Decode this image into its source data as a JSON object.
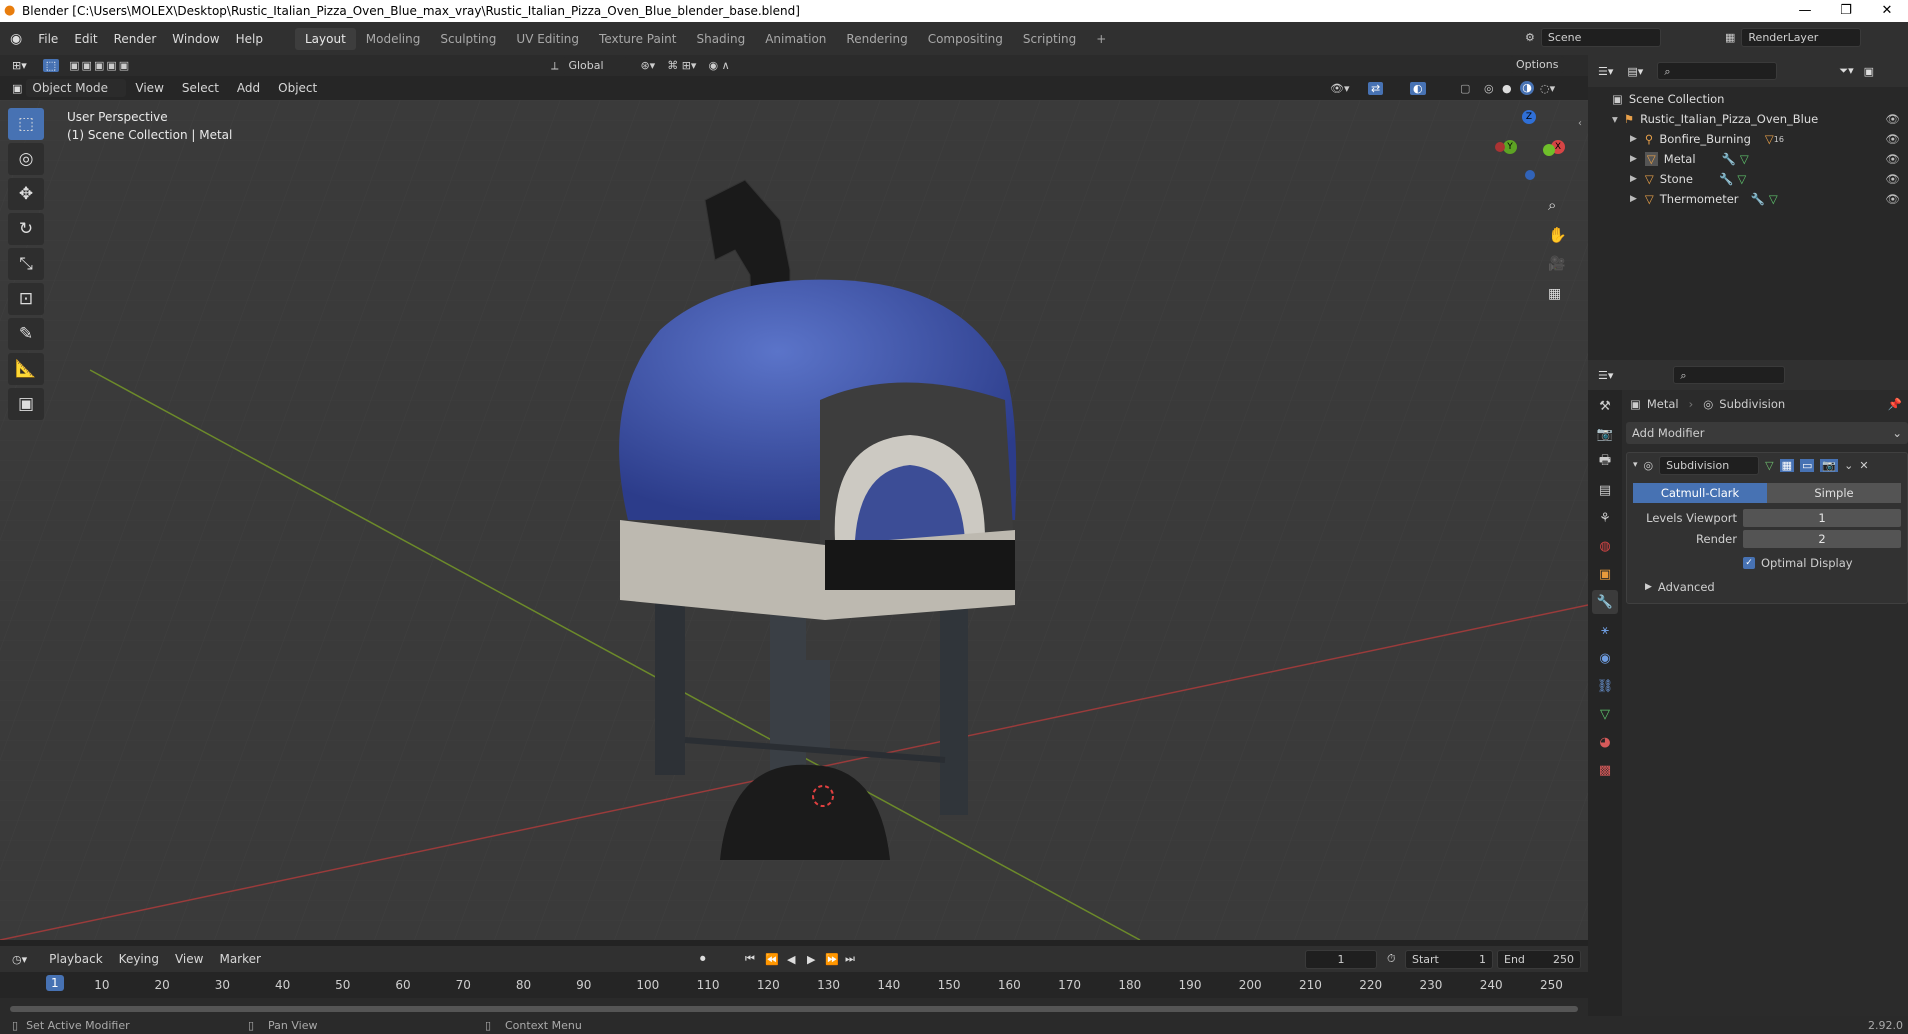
{
  "window": {
    "title": "Blender [C:\\Users\\MOLEX\\Desktop\\Rustic_Italian_Pizza_Oven_Blue_max_vray\\Rustic_Italian_Pizza_Oven_Blue_blender_base.blend]",
    "minimize": "—",
    "maximize": "❐",
    "close": "✕"
  },
  "menu": [
    "File",
    "Edit",
    "Render",
    "Window",
    "Help"
  ],
  "workspaces": [
    "Layout",
    "Modeling",
    "Sculpting",
    "UV Editing",
    "Texture Paint",
    "Shading",
    "Animation",
    "Rendering",
    "Compositing",
    "Scripting"
  ],
  "workspace_add": "+",
  "scene": {
    "label": "Scene",
    "render_layer": "RenderLayer"
  },
  "viewport_header": {
    "transform_orientation": "Global",
    "options": "Options",
    "mode": "Object Mode",
    "menus": [
      "View",
      "Select",
      "Add",
      "Object"
    ]
  },
  "viewport": {
    "perspective": "User Perspective",
    "collection_info": "(1) Scene Collection | Metal",
    "gizmo": {
      "x": "X",
      "y": "Y",
      "z": "Z"
    }
  },
  "outliner": {
    "root": "Scene Collection",
    "collection": "Rustic_Italian_Pizza_Oven_Blue",
    "items": [
      {
        "name": "Bonfire_Burning",
        "badge": "16"
      },
      {
        "name": "Metal",
        "badge": ""
      },
      {
        "name": "Stone",
        "badge": ""
      },
      {
        "name": "Thermometer",
        "badge": ""
      }
    ]
  },
  "properties": {
    "breadcrumb_object": "Metal",
    "breadcrumb_modifier": "Subdivision",
    "add_modifier": "Add Modifier",
    "modifier": {
      "name": "Subdivision",
      "mode_catmull": "Catmull-Clark",
      "mode_simple": "Simple",
      "levels_viewport_label": "Levels Viewport",
      "levels_viewport_value": "1",
      "render_label": "Render",
      "render_value": "2",
      "optimal_display": "Optimal Display",
      "advanced": "Advanced"
    }
  },
  "timeline": {
    "menus": [
      "Playback",
      "Keying",
      "View",
      "Marker"
    ],
    "current_frame": "1",
    "start_label": "Start",
    "start_value": "1",
    "end_label": "End",
    "end_value": "250",
    "ticks": [
      "10",
      "20",
      "30",
      "40",
      "50",
      "60",
      "70",
      "80",
      "90",
      "100",
      "110",
      "120",
      "130",
      "140",
      "150",
      "160",
      "170",
      "180",
      "190",
      "200",
      "210",
      "220",
      "230",
      "240",
      "250"
    ]
  },
  "status": {
    "left": "Set Active Modifier",
    "middle": "Pan View",
    "right": "Context Menu",
    "version": "2.92.0"
  },
  "colors": {
    "accent": "#4772b3",
    "viewport_bg": "#3a3a3a",
    "panel": "#2b2b2b"
  }
}
